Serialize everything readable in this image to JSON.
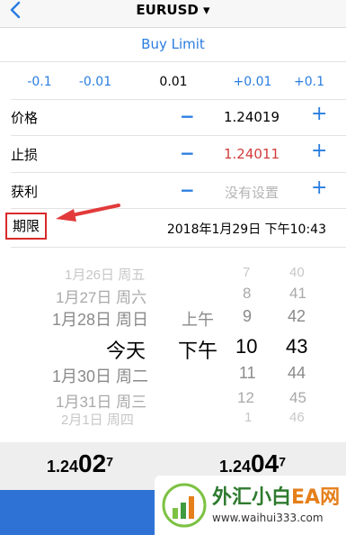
{
  "header": {
    "title": "EURUSD ▾"
  },
  "order_type": "Buy Limit",
  "steps": [
    "-0.1",
    "-0.01",
    "0.01",
    "+0.01",
    "+0.1"
  ],
  "rows": [
    {
      "label": "价格",
      "value": "1.24019"
    },
    {
      "label": "止损",
      "value": "1.24011",
      "color": "#d33b3b"
    },
    {
      "label": "获利",
      "value": "没有设置"
    }
  ],
  "expiry": {
    "label": "期限",
    "value": "2018年1月29日 下午10:43"
  },
  "picker": {
    "dates": [
      "1月26日 周五",
      "1月27日 周六",
      "1月28日 周日",
      "今天",
      "1月30日 周二",
      "1月31日 周三",
      "2月1日 周四"
    ],
    "ampm": [
      "上午",
      "下午"
    ],
    "hours": [
      "7",
      "8",
      "9",
      "10",
      "11",
      "12",
      "1"
    ],
    "minutes": [
      "40",
      "41",
      "42",
      "43",
      "44",
      "45",
      "46"
    ]
  },
  "quotes": {
    "bid": {
      "small": "1.24",
      "big": "02",
      "sup": "7"
    },
    "ask": {
      "small": "1.24",
      "big": "04",
      "sup": "7"
    }
  },
  "watermark": {
    "title_cn": "外汇小白",
    "title_ea": "EA网",
    "url": "www.waihui333.com"
  },
  "colors": {
    "accent": "#2a7de1",
    "stop_loss": "#d33b3b",
    "highlight_box": "#d92a2a",
    "action_bar": "#2f72d6"
  }
}
